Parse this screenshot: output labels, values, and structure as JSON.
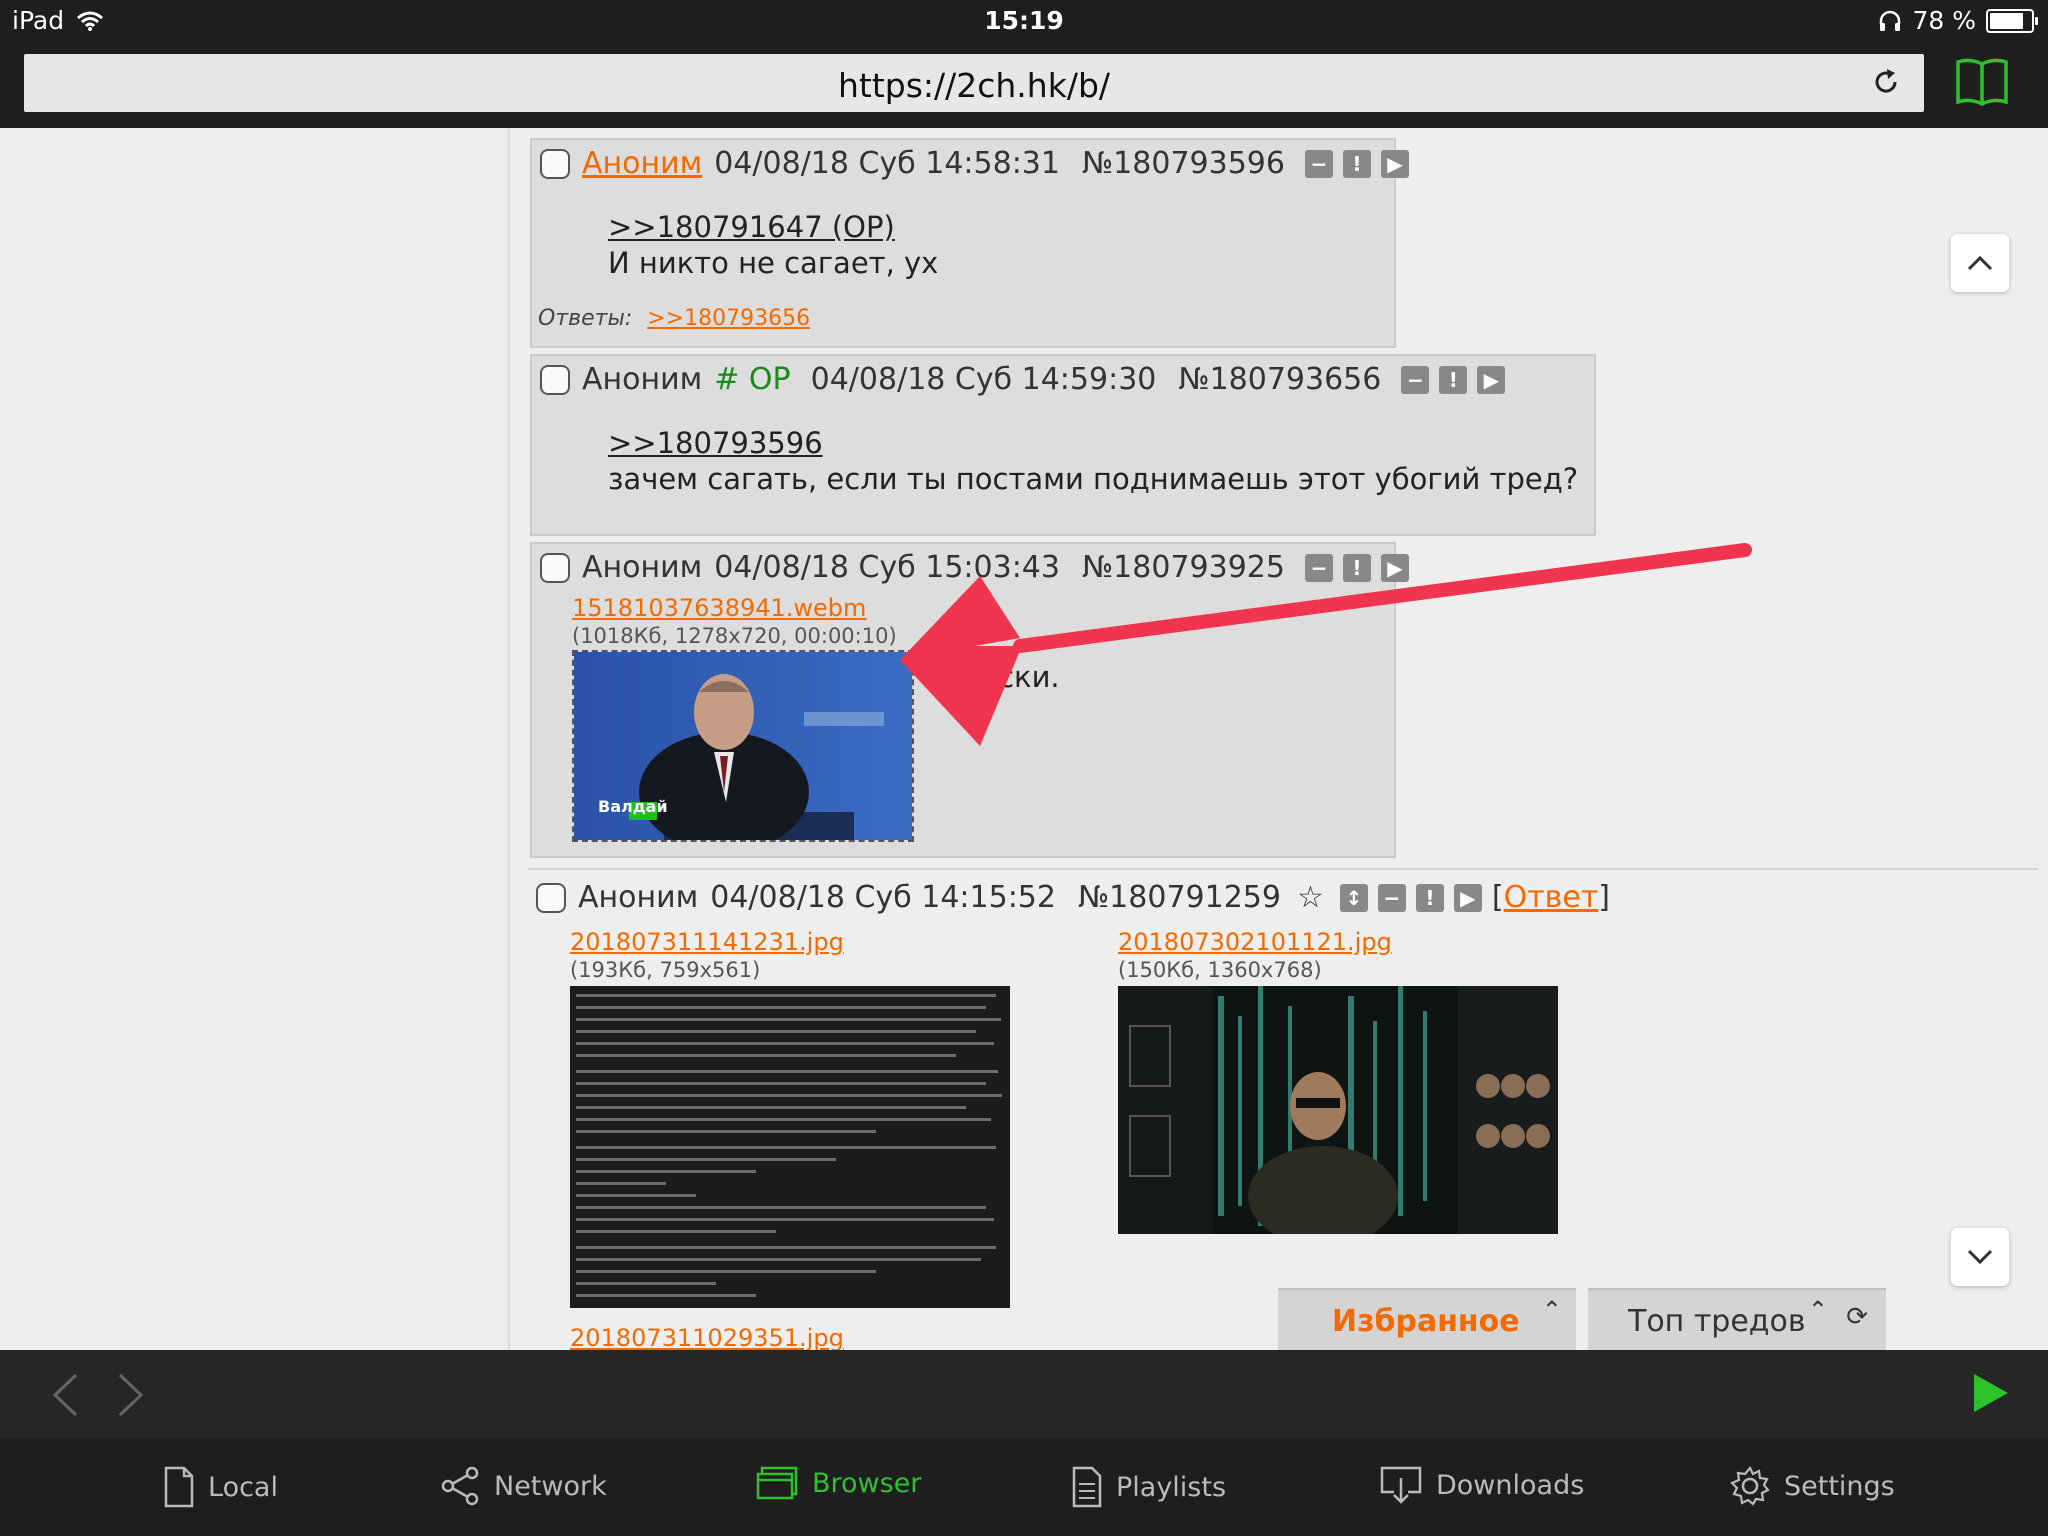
{
  "status_bar": {
    "device": "iPad",
    "time": "15:19",
    "battery": "78 %",
    "battery_level": 0.78
  },
  "browser": {
    "url": "https://2ch.hk/b/"
  },
  "posts": [
    {
      "name": "Аноним",
      "date": "04/08/18 Суб 14:58:31",
      "number": "№180793596",
      "reply_link": ">>180791647 (OP)",
      "message": "И никто не сагает, ух",
      "replies_label": "Ответы:",
      "reply_ref": ">>180793656"
    },
    {
      "name": "Аноним",
      "trip": "# OP",
      "date": "04/08/18 Суб 14:59:30",
      "number": "№180793656",
      "reply_link": ">>180793596",
      "message": "зачем сагать, если ты постами поднимаешь этот убогий тред?"
    },
    {
      "name": "Аноним",
      "date": "04/08/18 Суб 15:03:43",
      "number": "№180793925",
      "file_name": "15181037638941.webm",
      "file_info": "(1018Кб, 1278x720, 00:00:10)",
      "thumb_caption": "Валдай",
      "message": "ириски."
    },
    {
      "name": "Аноним",
      "date": "04/08/18 Суб 14:15:52",
      "number": "№180791259",
      "reply_label": "Ответ",
      "files": [
        {
          "name": "201807311141231.jpg",
          "info": "(193Кб, 759x561)"
        },
        {
          "name": "201807302101121.jpg",
          "info": "(150Кб, 1360x768)"
        },
        {
          "name": "201807311029351.jpg",
          "info": ""
        }
      ]
    }
  ],
  "floating_tabs": {
    "favorites": "Избранное",
    "top_threads": "Топ тредов"
  },
  "tab_bar": {
    "items": [
      {
        "label": "Local",
        "icon": "document-icon"
      },
      {
        "label": "Network",
        "icon": "share-icon"
      },
      {
        "label": "Browser",
        "icon": "browser-icon"
      },
      {
        "label": "Playlists",
        "icon": "playlist-icon"
      },
      {
        "label": "Downloads",
        "icon": "download-icon"
      },
      {
        "label": "Settings",
        "icon": "gear-icon"
      }
    ]
  },
  "colors": {
    "link": "#f26a00",
    "accent_green": "#2ec12e",
    "annotation_arrow": "#f0364f",
    "trip": "#1a8a1a"
  }
}
